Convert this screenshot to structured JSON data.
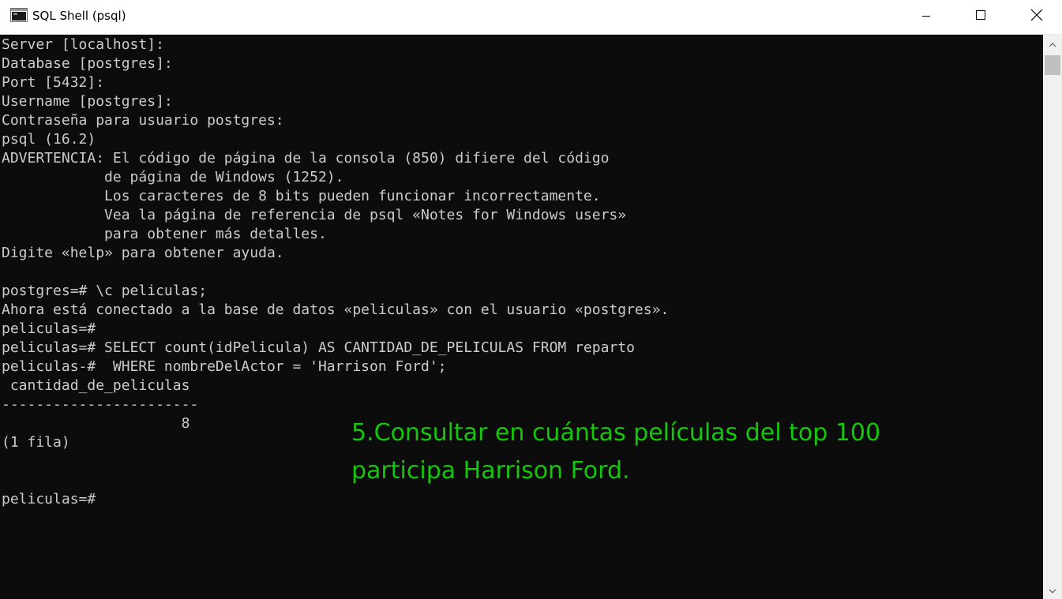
{
  "window": {
    "title": "SQL Shell (psql)"
  },
  "icons": {
    "app": "console-app-icon",
    "minimize": "minimize-icon",
    "maximize": "maximize-icon",
    "close": "close-icon",
    "scroll_up": "chevron-up-icon",
    "scroll_down": "chevron-down-icon"
  },
  "colors": {
    "console_background": "#0c0c0c",
    "console_text": "#cccccc",
    "annotation_text": "#16c60c"
  },
  "console": {
    "lines": [
      "Server [localhost]:",
      "Database [postgres]:",
      "Port [5432]:",
      "Username [postgres]:",
      "Contraseña para usuario postgres:",
      "psql (16.2)",
      "ADVERTENCIA: El código de página de la consola (850) difiere del código",
      "            de página de Windows (1252).",
      "            Los caracteres de 8 bits pueden funcionar incorrectamente.",
      "            Vea la página de referencia de psql «Notes for Windows users»",
      "            para obtener más detalles.",
      "Digite «help» para obtener ayuda.",
      "",
      "postgres=# \\c peliculas;",
      "Ahora está conectado a la base de datos «peliculas» con el usuario «postgres».",
      "peliculas=#",
      "peliculas=# SELECT count(idPelicula) AS CANTIDAD_DE_PELICULAS FROM reparto",
      "peliculas-#  WHERE nombreDelActor = 'Harrison Ford';",
      " cantidad_de_peliculas",
      "-----------------------",
      "                     8",
      "(1 fila)",
      "",
      "",
      "peliculas=#"
    ]
  },
  "annotation": {
    "line1": "5.Consultar en cuántas películas del top 100",
    "line2": "participa Harrison Ford."
  }
}
